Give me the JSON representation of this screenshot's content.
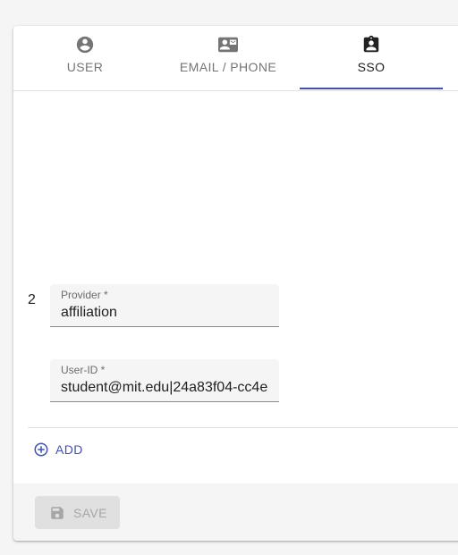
{
  "tabs": [
    {
      "label": "USER",
      "icon": "account-circle-icon",
      "active": false
    },
    {
      "label": "EMAIL / PHONE",
      "icon": "contact-mail-icon",
      "active": false
    },
    {
      "label": "SSO",
      "icon": "assignment-ind-icon",
      "active": true
    }
  ],
  "sso": {
    "row_index": "2",
    "provider": {
      "label": "Provider *",
      "value": "affiliation"
    },
    "user_id": {
      "label": "User-ID *",
      "value": "student@mit.edu|24a83f04-cc4e"
    }
  },
  "add_button": {
    "label": "ADD",
    "icon": "add-circle-outline-icon"
  },
  "save_button": {
    "label": "SAVE",
    "icon": "save-icon",
    "disabled": true
  },
  "colors": {
    "accent": "#3f51b5",
    "disabled_text": "#a6a6a6",
    "disabled_bg": "#e0e0e0"
  }
}
